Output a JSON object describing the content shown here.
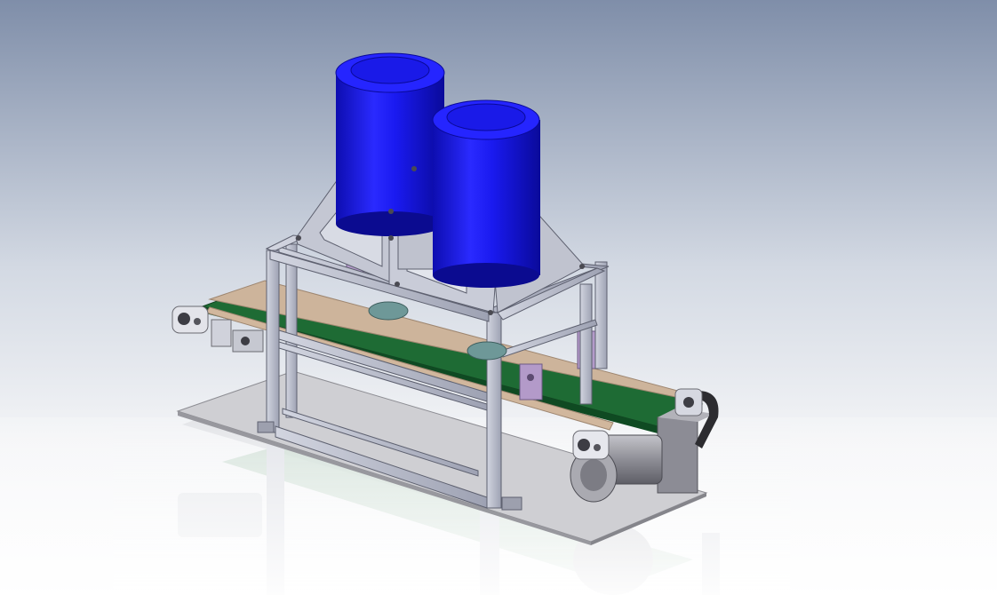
{
  "viewport": {
    "background_top": "#7a8aa6",
    "background_mid": "#dfe4ec",
    "background_bottom": "#ffffff"
  },
  "model": {
    "canister_color": "#1414e6",
    "belt_color": "#1e6b34",
    "frame_color": "#b8bccb",
    "guide_rail_color": "#c8ad92",
    "base_plate_color": "#cfcfd3",
    "motor_color": "#a6a6ad",
    "bracket_color": "#b39ac9",
    "show_floor_reflection": true
  }
}
